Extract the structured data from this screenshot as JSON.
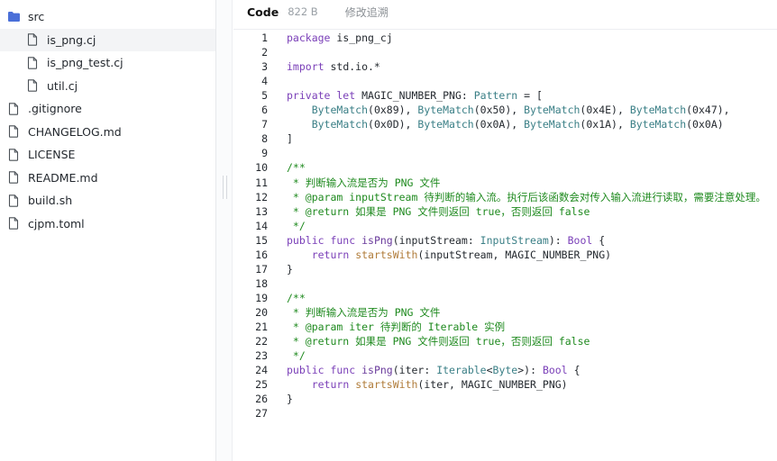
{
  "sidebar": {
    "items": [
      {
        "label": "src",
        "icon": "folder-icon",
        "indent": false,
        "selected": false
      },
      {
        "label": "is_png.cj",
        "icon": "file-icon",
        "indent": true,
        "selected": true
      },
      {
        "label": "is_png_test.cj",
        "icon": "file-icon",
        "indent": true,
        "selected": false
      },
      {
        "label": "util.cj",
        "icon": "file-icon",
        "indent": true,
        "selected": false
      },
      {
        "label": ".gitignore",
        "icon": "file-icon",
        "indent": false,
        "selected": false
      },
      {
        "label": "CHANGELOG.md",
        "icon": "file-icon",
        "indent": false,
        "selected": false
      },
      {
        "label": "LICENSE",
        "icon": "file-icon",
        "indent": false,
        "selected": false
      },
      {
        "label": "README.md",
        "icon": "file-icon",
        "indent": false,
        "selected": false
      },
      {
        "label": "build.sh",
        "icon": "file-icon",
        "indent": false,
        "selected": false
      },
      {
        "label": "cjpm.toml",
        "icon": "file-icon",
        "indent": false,
        "selected": false
      }
    ]
  },
  "header": {
    "code_tab": "Code",
    "size": "822 B",
    "history": "修改追溯"
  },
  "colors": {
    "keyword": "#7a3fb8",
    "type": "#3a7f86",
    "function": "#6a3b9c",
    "call": "#b07c3a",
    "comment": "#1f8a1f",
    "folder": "#4a6fd8"
  },
  "code": {
    "lines": [
      {
        "n": "1",
        "tokens": [
          [
            "kw",
            "package"
          ],
          [
            "p",
            " is_png_cj"
          ]
        ]
      },
      {
        "n": "2",
        "tokens": []
      },
      {
        "n": "3",
        "tokens": [
          [
            "kw",
            "import"
          ],
          [
            "p",
            " std.io.*"
          ]
        ]
      },
      {
        "n": "4",
        "tokens": []
      },
      {
        "n": "5",
        "tokens": [
          [
            "kw",
            "private let"
          ],
          [
            "p",
            " MAGIC_NUMBER_PNG: "
          ],
          [
            "typ",
            "Pattern"
          ],
          [
            "p",
            " = ["
          ]
        ]
      },
      {
        "n": "6",
        "tokens": [
          [
            "p",
            "    "
          ],
          [
            "typ",
            "ByteMatch"
          ],
          [
            "p",
            "(0x89), "
          ],
          [
            "typ",
            "ByteMatch"
          ],
          [
            "p",
            "(0x50), "
          ],
          [
            "typ",
            "ByteMatch"
          ],
          [
            "p",
            "(0x4E), "
          ],
          [
            "typ",
            "ByteMatch"
          ],
          [
            "p",
            "(0x47),"
          ]
        ]
      },
      {
        "n": "7",
        "tokens": [
          [
            "p",
            "    "
          ],
          [
            "typ",
            "ByteMatch"
          ],
          [
            "p",
            "(0x0D), "
          ],
          [
            "typ",
            "ByteMatch"
          ],
          [
            "p",
            "(0x0A), "
          ],
          [
            "typ",
            "ByteMatch"
          ],
          [
            "p",
            "(0x1A), "
          ],
          [
            "typ",
            "ByteMatch"
          ],
          [
            "p",
            "(0x0A)"
          ]
        ]
      },
      {
        "n": "8",
        "tokens": [
          [
            "p",
            "]"
          ]
        ]
      },
      {
        "n": "9",
        "tokens": []
      },
      {
        "n": "10",
        "tokens": [
          [
            "cmt",
            "/**"
          ]
        ]
      },
      {
        "n": "11",
        "tokens": [
          [
            "cmt",
            " * 判断输入流是否为 PNG 文件"
          ]
        ]
      },
      {
        "n": "12",
        "tokens": [
          [
            "cmt",
            " * @param inputStream 待判断的输入流。执行后该函数会对传入输入流进行读取，需要注意处理。"
          ]
        ]
      },
      {
        "n": "13",
        "tokens": [
          [
            "cmt",
            " * @return 如果是 PNG 文件则返回 true，否则返回 false"
          ]
        ]
      },
      {
        "n": "14",
        "tokens": [
          [
            "cmt",
            " */"
          ]
        ]
      },
      {
        "n": "15",
        "tokens": [
          [
            "kw",
            "public func"
          ],
          [
            "p",
            " "
          ],
          [
            "fn",
            "isPng"
          ],
          [
            "p",
            "(inputStream: "
          ],
          [
            "typ",
            "InputStream"
          ],
          [
            "p",
            "): "
          ],
          [
            "kw",
            "Bool"
          ],
          [
            "p",
            " {"
          ]
        ]
      },
      {
        "n": "16",
        "tokens": [
          [
            "p",
            "    "
          ],
          [
            "kw",
            "return"
          ],
          [
            "p",
            " "
          ],
          [
            "mcall",
            "startsWith"
          ],
          [
            "p",
            "(inputStream, MAGIC_NUMBER_PNG)"
          ]
        ]
      },
      {
        "n": "17",
        "tokens": [
          [
            "p",
            "}"
          ]
        ]
      },
      {
        "n": "18",
        "tokens": []
      },
      {
        "n": "19",
        "tokens": [
          [
            "cmt",
            "/**"
          ]
        ]
      },
      {
        "n": "20",
        "tokens": [
          [
            "cmt",
            " * 判断输入流是否为 PNG 文件"
          ]
        ]
      },
      {
        "n": "21",
        "tokens": [
          [
            "cmt",
            " * @param iter 待判断的 Iterable 实例"
          ]
        ]
      },
      {
        "n": "22",
        "tokens": [
          [
            "cmt",
            " * @return 如果是 PNG 文件则返回 true，否则返回 false"
          ]
        ]
      },
      {
        "n": "23",
        "tokens": [
          [
            "cmt",
            " */"
          ]
        ]
      },
      {
        "n": "24",
        "tokens": [
          [
            "kw",
            "public func"
          ],
          [
            "p",
            " "
          ],
          [
            "fn",
            "isPng"
          ],
          [
            "p",
            "(iter: "
          ],
          [
            "typ",
            "Iterable"
          ],
          [
            "p",
            "<"
          ],
          [
            "typ",
            "Byte"
          ],
          [
            "p",
            ">): "
          ],
          [
            "kw",
            "Bool"
          ],
          [
            "p",
            " {"
          ]
        ]
      },
      {
        "n": "25",
        "tokens": [
          [
            "p",
            "    "
          ],
          [
            "kw",
            "return"
          ],
          [
            "p",
            " "
          ],
          [
            "mcall",
            "startsWith"
          ],
          [
            "p",
            "(iter, MAGIC_NUMBER_PNG)"
          ]
        ]
      },
      {
        "n": "26",
        "tokens": [
          [
            "p",
            "}"
          ]
        ]
      },
      {
        "n": "27",
        "tokens": []
      }
    ]
  }
}
